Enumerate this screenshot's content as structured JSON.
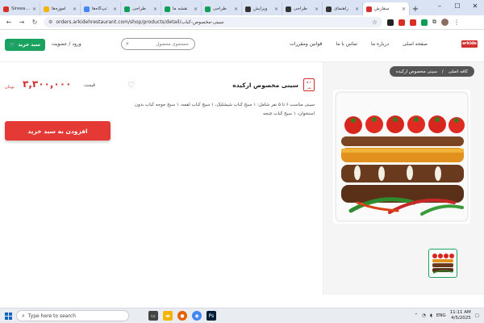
{
  "browser": {
    "tabs": [
      {
        "title": "Sireeage",
        "color": "#d93025"
      },
      {
        "title": "آموزه‌ها",
        "color": "#f4b400"
      },
      {
        "title": "تپ‌‌گاه‌ها",
        "color": "#4285f4"
      },
      {
        "title": "طراحی",
        "color": "#0f9d58"
      },
      {
        "title": "نقشه‌ ما",
        "color": "#0f9d58"
      },
      {
        "title": "طراحی",
        "color": "#0f9d58"
      },
      {
        "title": "ویرایش",
        "color": "#333333"
      },
      {
        "title": "طراحی",
        "color": "#333333"
      },
      {
        "title": "راهنمای",
        "color": "#333333"
      },
      {
        "title": "سفارش",
        "color": "#d32f2f"
      }
    ],
    "new_tab": "+",
    "url": "orders.arkidehrestaurant.com/shop/products/detail/سینی-مخصوص-کباب",
    "extensions": [
      {
        "name": "pen-icon",
        "color": "#222222"
      },
      {
        "name": "pdf-icon",
        "color": "#d93025"
      },
      {
        "name": "ext-icon",
        "color": "#d93025"
      },
      {
        "name": "grammar-icon",
        "color": "#0f9d58"
      }
    ]
  },
  "header": {
    "cart_label": "سبد خرید",
    "login_label": "ورود / عضویت",
    "search_placeholder": "جستجوی محصول",
    "nav": [
      "صفحه اصلی",
      "درباره ما",
      "تماس با ما",
      "قوانین ومقررات"
    ],
    "logo": "arkide"
  },
  "product": {
    "breadcrumb": [
      "کافه اصلی",
      "/",
      "سینی مخصوص ارکیده"
    ],
    "title": "سینی مخصوص ارکیده",
    "badge_top": "۵-۶",
    "badge_bottom": "نفر",
    "price_label": "قیمت",
    "price": "۳,۳۰۰,۰۰۰",
    "currency": "تومان",
    "description": "سینی مناسب ۶ تا ۵ نفر شامل: ۱ سیخ کباب شیشلیک، ۱ سیخ کباب لقمه، ۱ سیخ جوجه کباب بدون استخوان، ۱ سیخ کباب چنجه",
    "add_to_cart": "افزودن به سبد خرید"
  },
  "taskbar": {
    "search_placeholder": "Type here to search",
    "time": "11:11 AM",
    "date": "4/5/2025",
    "lang": "ENG",
    "apps": [
      {
        "name": "task-view-icon",
        "color": "#444444"
      },
      {
        "name": "file-explorer-icon",
        "color": "#f4b400"
      },
      {
        "name": "firefox-icon",
        "color": "#e66000"
      },
      {
        "name": "chrome-icon",
        "color": "#4285f4"
      },
      {
        "name": "photoshop-icon",
        "color": "#001e36"
      }
    ]
  },
  "colors": {
    "accent_green": "#1aa260",
    "accent_red": "#e53935",
    "price_red": "#d32f2f"
  }
}
